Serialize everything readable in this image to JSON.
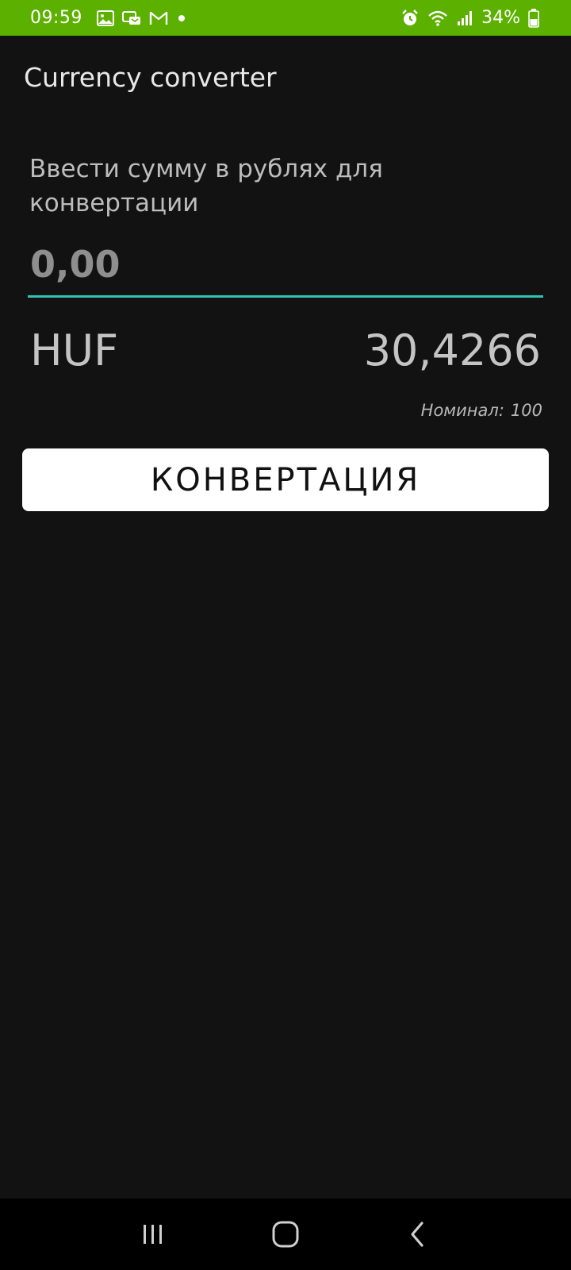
{
  "status_bar": {
    "time": "09:59",
    "left_icons": [
      "gallery-icon",
      "messenger-icon",
      "gmail-icon",
      "notification-dot-icon"
    ],
    "right_icons": [
      "alarm-icon",
      "wifi-icon",
      "signal-icon",
      "battery-icon"
    ],
    "battery": "34%",
    "background": "#5cb100"
  },
  "app": {
    "title": "Currency converter"
  },
  "form": {
    "prompt": "Ввести сумму в рублях для конвертации",
    "amount_placeholder": "0,00",
    "amount_value": "",
    "accent": "#2ec4b6"
  },
  "result": {
    "currency_code": "HUF",
    "rate": "30,4266",
    "nominal_label": "Номинал:",
    "nominal_value": "100"
  },
  "button": {
    "convert_label": "КОНВЕРТАЦИЯ"
  },
  "nav_bar": {
    "icons": [
      "recent-apps-icon",
      "home-icon",
      "back-icon"
    ]
  }
}
